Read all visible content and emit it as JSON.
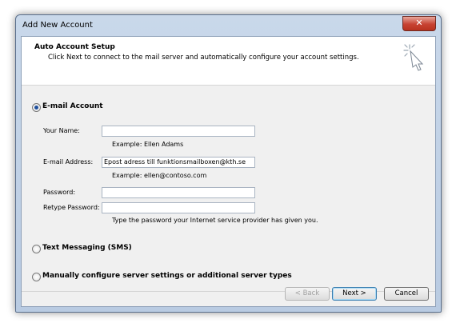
{
  "window": {
    "title": "Add New Account",
    "close_glyph": "✕"
  },
  "header": {
    "title": "Auto Account Setup",
    "subtitle": "Click Next to connect to the mail server and automatically configure your account settings.",
    "icon": "wizard-wand-icon"
  },
  "options": {
    "email_account": {
      "label": "E-mail Account",
      "selected": true
    },
    "text_messaging": {
      "label": "Text Messaging (SMS)",
      "selected": false
    },
    "manual": {
      "label": "Manually configure server settings or additional server types",
      "selected": false
    }
  },
  "form": {
    "your_name": {
      "label": "Your Name:",
      "value": "",
      "hint": "Example: Ellen Adams"
    },
    "email_address": {
      "label": "E-mail Address:",
      "value": "Epost adress till funktionsmailboxen@kth.se",
      "hint": "Example: ellen@contoso.com"
    },
    "password": {
      "label": "Password:",
      "value": ""
    },
    "retype_password": {
      "label": "Retype Password:",
      "value": ""
    },
    "password_hint": "Type the password your Internet service provider has given you."
  },
  "buttons": {
    "back": "< Back",
    "next": "Next >",
    "cancel": "Cancel"
  }
}
